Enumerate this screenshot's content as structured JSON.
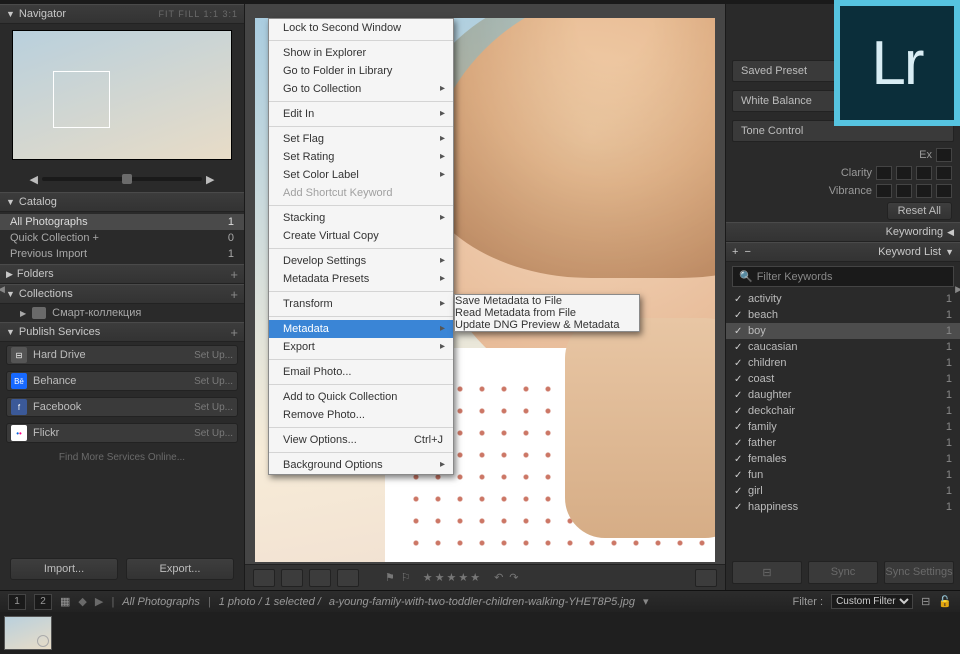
{
  "navigator": {
    "title": "Navigator",
    "modes": "FIT  FILL  1:1  3:1"
  },
  "catalog": {
    "title": "Catalog",
    "rows": [
      {
        "label": "All Photographs",
        "count": "1",
        "sel": true
      },
      {
        "label": "Quick Collection +",
        "count": "0"
      },
      {
        "label": "Previous Import",
        "count": "1"
      }
    ]
  },
  "folders": {
    "title": "Folders"
  },
  "collections": {
    "title": "Collections",
    "item": "Смарт-коллекция"
  },
  "publish": {
    "title": "Publish Services",
    "rows": [
      {
        "label": "Hard Drive",
        "setup": "Set Up...",
        "bg": "#555"
      },
      {
        "label": "Behance",
        "setup": "Set Up...",
        "bg": "#1769ff"
      },
      {
        "label": "Facebook",
        "setup": "Set Up...",
        "bg": "#3b5998"
      },
      {
        "label": "Flickr",
        "setup": "Set Up...",
        "bg": "#fff"
      }
    ],
    "findmore": "Find More Services Online..."
  },
  "buttons": {
    "import": "Import...",
    "export": "Export..."
  },
  "ctx": {
    "items": [
      {
        "t": "Lock to Second Window"
      },
      {
        "sep": true
      },
      {
        "t": "Show in Explorer"
      },
      {
        "t": "Go to Folder in Library"
      },
      {
        "t": "Go to Collection",
        "sub": true
      },
      {
        "sep": true
      },
      {
        "t": "Edit In",
        "sub": true
      },
      {
        "sep": true
      },
      {
        "t": "Set Flag",
        "sub": true
      },
      {
        "t": "Set Rating",
        "sub": true
      },
      {
        "t": "Set Color Label",
        "sub": true
      },
      {
        "t": "Add Shortcut Keyword",
        "dis": true
      },
      {
        "sep": true
      },
      {
        "t": "Stacking",
        "sub": true
      },
      {
        "t": "Create Virtual Copy"
      },
      {
        "sep": true
      },
      {
        "t": "Develop Settings",
        "sub": true
      },
      {
        "t": "Metadata Presets",
        "sub": true
      },
      {
        "sep": true
      },
      {
        "t": "Transform",
        "sub": true
      },
      {
        "sep": true
      },
      {
        "t": "Metadata",
        "sub": true,
        "hl": true
      },
      {
        "t": "Export",
        "sub": true
      },
      {
        "sep": true
      },
      {
        "t": "Email Photo..."
      },
      {
        "sep": true
      },
      {
        "t": "Add to Quick Collection"
      },
      {
        "t": "Remove Photo..."
      },
      {
        "sep": true
      },
      {
        "t": "View Options...",
        "shortcut": "Ctrl+J"
      },
      {
        "sep": true
      },
      {
        "t": "Background Options",
        "sub": true
      }
    ],
    "submenu": [
      {
        "t": "Save Metadata to File"
      },
      {
        "t": "Read Metadata from File",
        "hl": true
      },
      {
        "t": "Update DNG Preview & Metadata",
        "dis": true
      }
    ]
  },
  "right": {
    "savedPreset": "Saved Preset",
    "whiteBalance": "White Balance",
    "toneControl": "Tone Control",
    "exposure": "Ex",
    "clarity": "Clarity",
    "vibrance": "Vibrance",
    "resetAll": "Reset All",
    "keywording": "Keywording",
    "keywordList": "Keyword List",
    "filterPh": "Filter Keywords",
    "kw": [
      {
        "w": "activity",
        "c": "1"
      },
      {
        "w": "beach",
        "c": "1"
      },
      {
        "w": "boy",
        "c": "1",
        "sel": true
      },
      {
        "w": "caucasian",
        "c": "1"
      },
      {
        "w": "children",
        "c": "1"
      },
      {
        "w": "coast",
        "c": "1"
      },
      {
        "w": "daughter",
        "c": "1"
      },
      {
        "w": "deckchair",
        "c": "1"
      },
      {
        "w": "family",
        "c": "1"
      },
      {
        "w": "father",
        "c": "1"
      },
      {
        "w": "females",
        "c": "1"
      },
      {
        "w": "fun",
        "c": "1"
      },
      {
        "w": "girl",
        "c": "1"
      },
      {
        "w": "happiness",
        "c": "1"
      }
    ],
    "sync": "Sync",
    "syncSettings": "Sync Settings"
  },
  "bot": {
    "p1": "1",
    "p2": "2",
    "bc1": "All Photographs",
    "bc2": "1 photo / 1 selected /",
    "bc3": "a-young-family-with-two-toddler-children-walking-YHET8P5.jpg",
    "filterLbl": "Filter :",
    "filterSel": "Custom Filter"
  },
  "lr": "Lr"
}
